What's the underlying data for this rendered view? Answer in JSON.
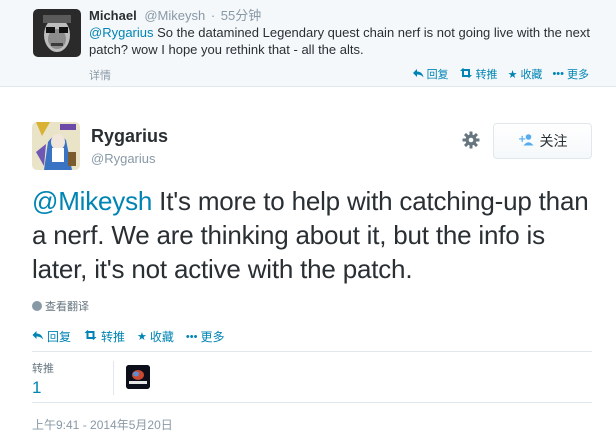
{
  "parent_tweet": {
    "name": "Michael",
    "handle": "@Mikeysh",
    "separator": "·",
    "time": "55分钟",
    "mention": "@Rygarius",
    "text": " So the datamined Legendary quest chain nerf is not going live with the next patch? wow I hope you rethink that - all the alts.",
    "details": "详情",
    "actions": {
      "reply": "回复",
      "retweet": "转推",
      "favorite": "收藏",
      "more": "更多"
    }
  },
  "main_tweet": {
    "name": "Rygarius",
    "handle": "@Rygarius",
    "follow_label": "关注",
    "mention": "@Mikeysh",
    "text": " It's more to help with catching-up than a nerf. We are thinking about it, but the info is later, it's not active with the patch.",
    "translate": "查看翻译",
    "actions": {
      "reply": "回复",
      "retweet": "转推",
      "favorite": "收藏",
      "more": "更多"
    },
    "stats": {
      "retweets_label": "转推",
      "retweets_count": "1"
    },
    "timestamp": "上午9:41 - 2014年5月20日"
  },
  "icons": {
    "reply": "reply-icon",
    "retweet": "retweet-icon",
    "favorite": "star-icon",
    "more": "more-dots-icon",
    "gear": "gear-icon",
    "follow": "add-user-icon",
    "globe": "globe-icon"
  },
  "colors": {
    "link": "#0084b4",
    "muted": "#8899a6",
    "text": "#292f33",
    "follow_icon": "#55acee",
    "context_bg": "#f5f8fa"
  }
}
